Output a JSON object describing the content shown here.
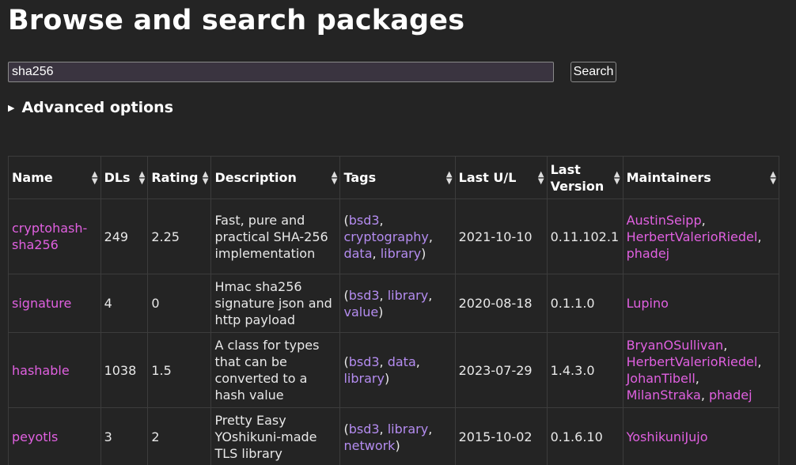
{
  "page": {
    "title": "Browse and search packages"
  },
  "search": {
    "value": "sha256",
    "button_label": "Search"
  },
  "advanced": {
    "label": "Advanced options"
  },
  "table": {
    "headers": {
      "name": "Name",
      "dls": "DLs",
      "rating": "Rating",
      "description": "Description",
      "tags": "Tags",
      "last_ul": "Last U/L",
      "last_version": "Last Version",
      "maintainers": "Maintainers"
    },
    "rows": [
      {
        "name": "cryptohash-sha256",
        "dls": "249",
        "rating": "2.25",
        "description": "Fast, pure and practical SHA-256 implementation",
        "tags": [
          "bsd3",
          "cryptography",
          "data",
          "library"
        ],
        "last_ul": "2021-10-10",
        "last_version": "0.11.102.1",
        "maintainers": [
          "AustinSeipp",
          "HerbertValerioRiedel",
          "phadej"
        ]
      },
      {
        "name": "signature",
        "dls": "4",
        "rating": "0",
        "description": "Hmac sha256 signature json and http payload",
        "tags": [
          "bsd3",
          "library",
          "value"
        ],
        "last_ul": "2020-08-18",
        "last_version": "0.1.1.0",
        "maintainers": [
          "Lupino"
        ]
      },
      {
        "name": "hashable",
        "dls": "1038",
        "rating": "1.5",
        "description": "A class for types that can be converted to a hash value",
        "tags": [
          "bsd3",
          "data",
          "library"
        ],
        "last_ul": "2023-07-29",
        "last_version": "1.4.3.0",
        "maintainers": [
          "BryanOSullivan",
          "HerbertValerioRiedel",
          "JohanTibell",
          "MilanStraka",
          "phadej"
        ]
      },
      {
        "name": "peyotls",
        "dls": "3",
        "rating": "2",
        "description": "Pretty Easy YOshikuni-made TLS library",
        "tags": [
          "bsd3",
          "library",
          "network"
        ],
        "last_ul": "2015-10-02",
        "last_version": "0.1.6.10",
        "maintainers": [
          "YoshikuniJujo"
        ]
      }
    ]
  },
  "colors": {
    "background": "#242424",
    "link": "#e060e0",
    "tag": "#b48cf0"
  },
  "icons": {
    "sort": "sort-arrows-icon",
    "disclosure": "disclosure-triangle-icon"
  }
}
